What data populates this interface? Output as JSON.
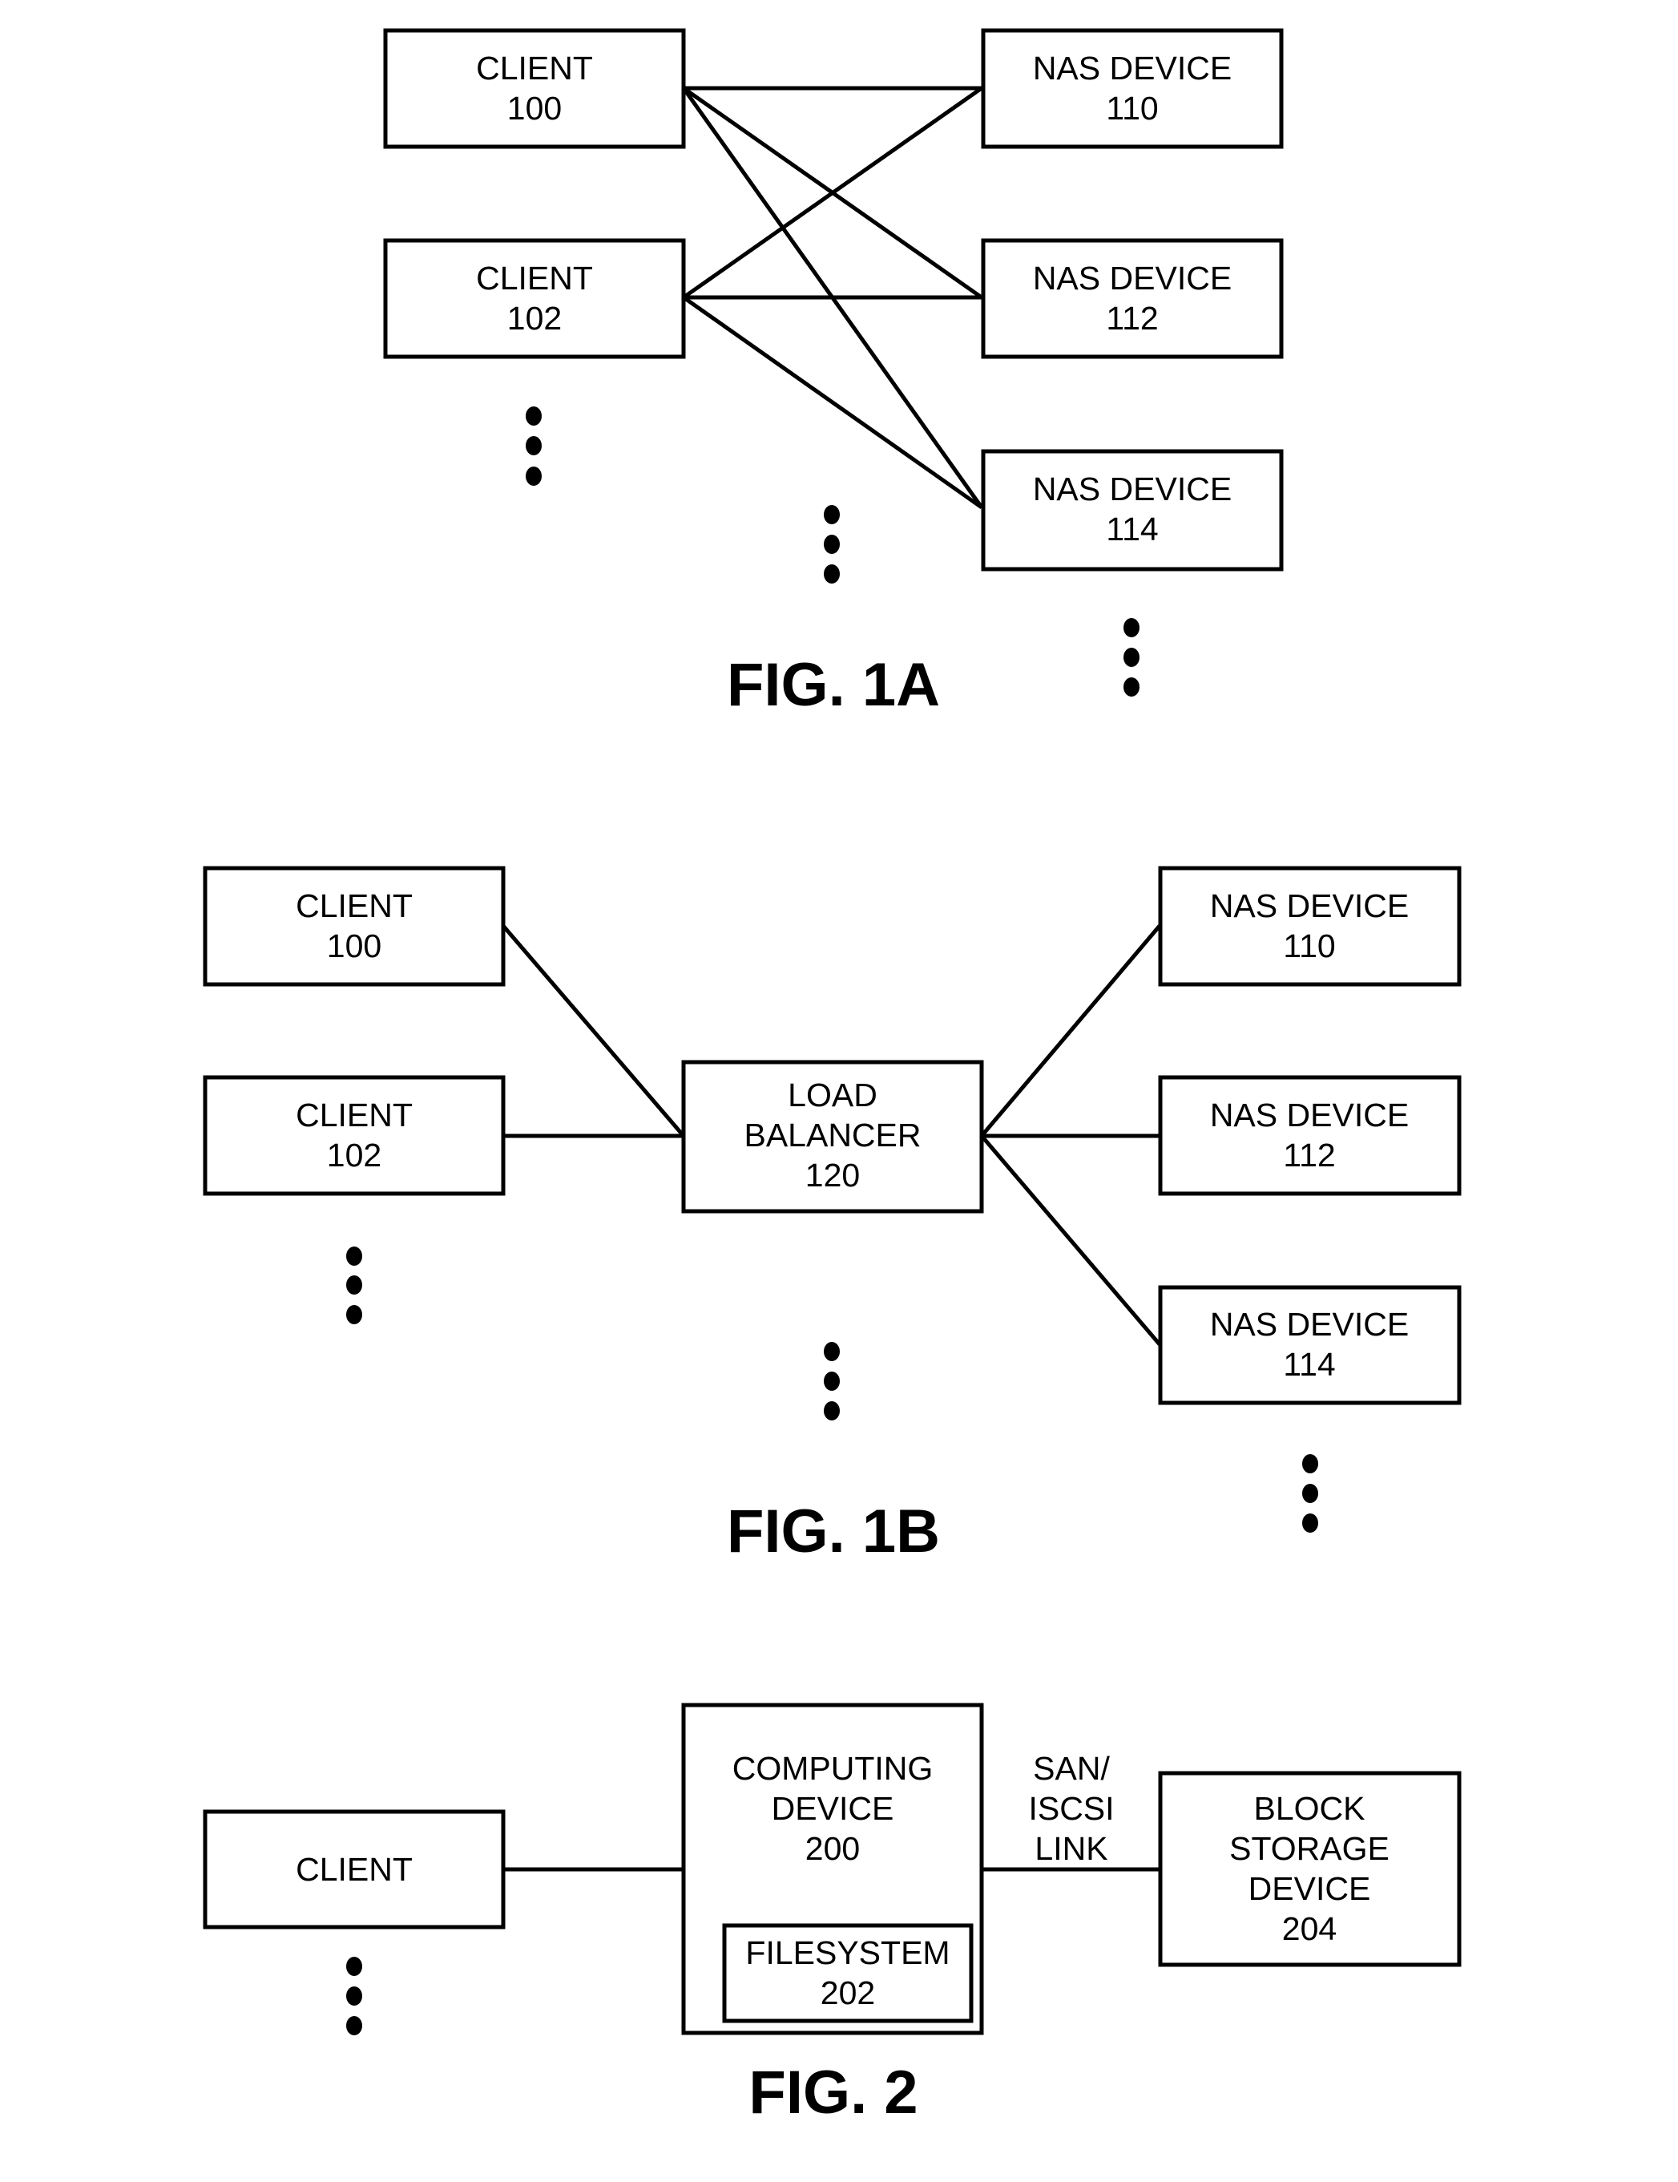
{
  "figures": {
    "fig1a": {
      "title": "FIG. 1A",
      "nodes": {
        "client100": [
          "CLIENT",
          "100"
        ],
        "client102": [
          "CLIENT",
          "102"
        ],
        "nas110": [
          "NAS DEVICE",
          "110"
        ],
        "nas112": [
          "NAS DEVICE",
          "112"
        ],
        "nas114": [
          "NAS DEVICE",
          "114"
        ]
      },
      "connections": [
        [
          "client100",
          "nas110"
        ],
        [
          "client100",
          "nas112"
        ],
        [
          "client100",
          "nas114"
        ],
        [
          "client102",
          "nas110"
        ],
        [
          "client102",
          "nas112"
        ],
        [
          "client102",
          "nas114"
        ]
      ]
    },
    "fig1b": {
      "title": "FIG. 1B",
      "nodes": {
        "client100": [
          "CLIENT",
          "100"
        ],
        "client102": [
          "CLIENT",
          "102"
        ],
        "lb120": [
          "LOAD",
          "BALANCER",
          "120"
        ],
        "nas110": [
          "NAS DEVICE",
          "110"
        ],
        "nas112": [
          "NAS DEVICE",
          "112"
        ],
        "nas114": [
          "NAS DEVICE",
          "114"
        ]
      },
      "connections": [
        [
          "client100",
          "lb120"
        ],
        [
          "client102",
          "lb120"
        ],
        [
          "lb120",
          "nas110"
        ],
        [
          "lb120",
          "nas112"
        ],
        [
          "lb120",
          "nas114"
        ]
      ]
    },
    "fig2": {
      "title": "FIG. 2",
      "nodes": {
        "client": [
          "CLIENT"
        ],
        "computing200": [
          "COMPUTING",
          "DEVICE",
          "200"
        ],
        "filesystem202": [
          "FILESYSTEM",
          "202"
        ],
        "block204": [
          "BLOCK",
          "STORAGE",
          "DEVICE",
          "204"
        ]
      },
      "link_label": [
        "SAN/",
        "ISCSI",
        "LINK"
      ],
      "connections": [
        [
          "client",
          "computing200"
        ],
        [
          "computing200",
          "block204"
        ]
      ]
    }
  },
  "ellipsis_glyph": "vertical-dots"
}
